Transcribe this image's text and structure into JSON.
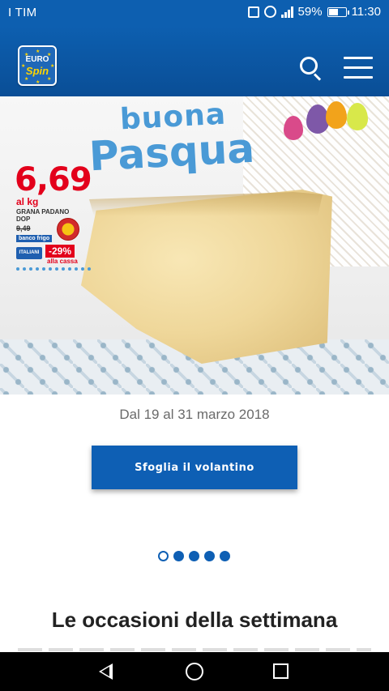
{
  "status_bar": {
    "carrier": "I TIM",
    "battery_percent": "59%",
    "battery_level": 0.59,
    "time": "11:30"
  },
  "header": {
    "logo": {
      "line1": "EURO",
      "line2": "Spin"
    },
    "icons": [
      "search-icon",
      "hamburger-menu-icon"
    ]
  },
  "banner": {
    "title_line1": "buona",
    "title_line2": "Pasqua",
    "price": "6,69",
    "price_unit": "al kg",
    "product_name": "GRANA PADANO DOP",
    "old_price": "9,49",
    "counter": "banco frigo",
    "brand_tag": "ITALIANI",
    "discount": "-29%",
    "discount_note": "alla cassa"
  },
  "promo": {
    "date_range": "Dal 19 al 31 marzo 2018",
    "cta_label": "Sfoglia il volantino"
  },
  "carousel": {
    "total": 5,
    "active_index": 0
  },
  "section": {
    "title": "Le occasioni della settimana"
  },
  "nav_bar": {
    "icons": [
      "back-icon",
      "home-icon",
      "recent-apps-icon"
    ]
  },
  "colors": {
    "brand_blue": "#0d5fb0",
    "accent_light_blue": "#4a9ad6",
    "price_red": "#e3001b"
  }
}
